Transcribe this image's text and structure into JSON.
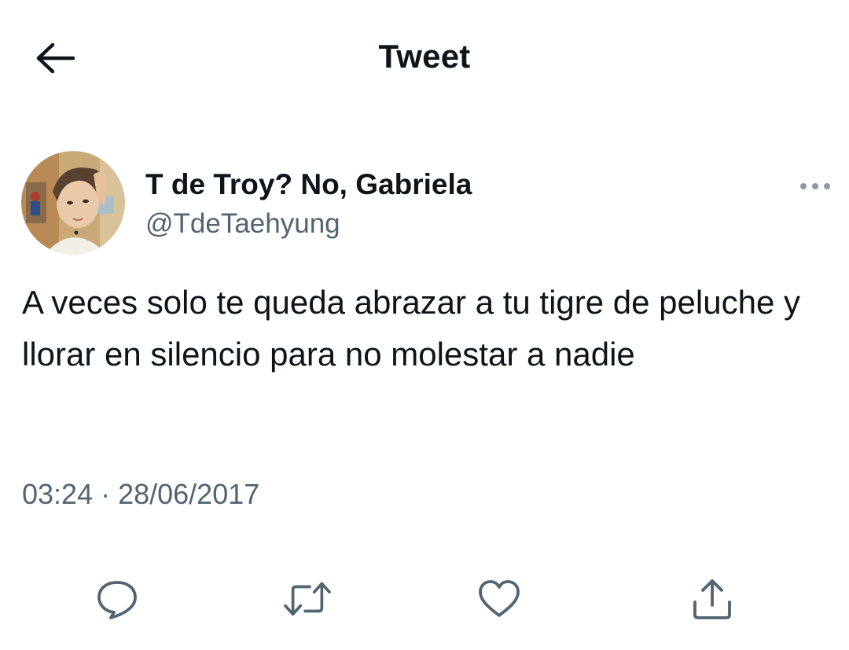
{
  "header": {
    "title": "Tweet",
    "back_icon": "arrow-left-icon"
  },
  "tweet": {
    "author": {
      "display_name": "T de Troy? No, Gabriela",
      "handle": "@TdeTaehyung",
      "avatar_icon": "avatar-photo"
    },
    "text": "A veces solo te queda abrazar a tu tigre de peluche y llorar en silencio para no molestar a nadie",
    "timestamp": "03:24 · 28/06/2017",
    "more_icon": "more-options-icon"
  },
  "actions": [
    {
      "name": "reply",
      "icon": "reply-icon"
    },
    {
      "name": "retweet",
      "icon": "retweet-icon"
    },
    {
      "name": "like",
      "icon": "heart-icon"
    },
    {
      "name": "share",
      "icon": "share-icon"
    }
  ],
  "colors": {
    "text_primary": "#0f1419",
    "text_secondary": "#536471",
    "background": "#ffffff"
  }
}
